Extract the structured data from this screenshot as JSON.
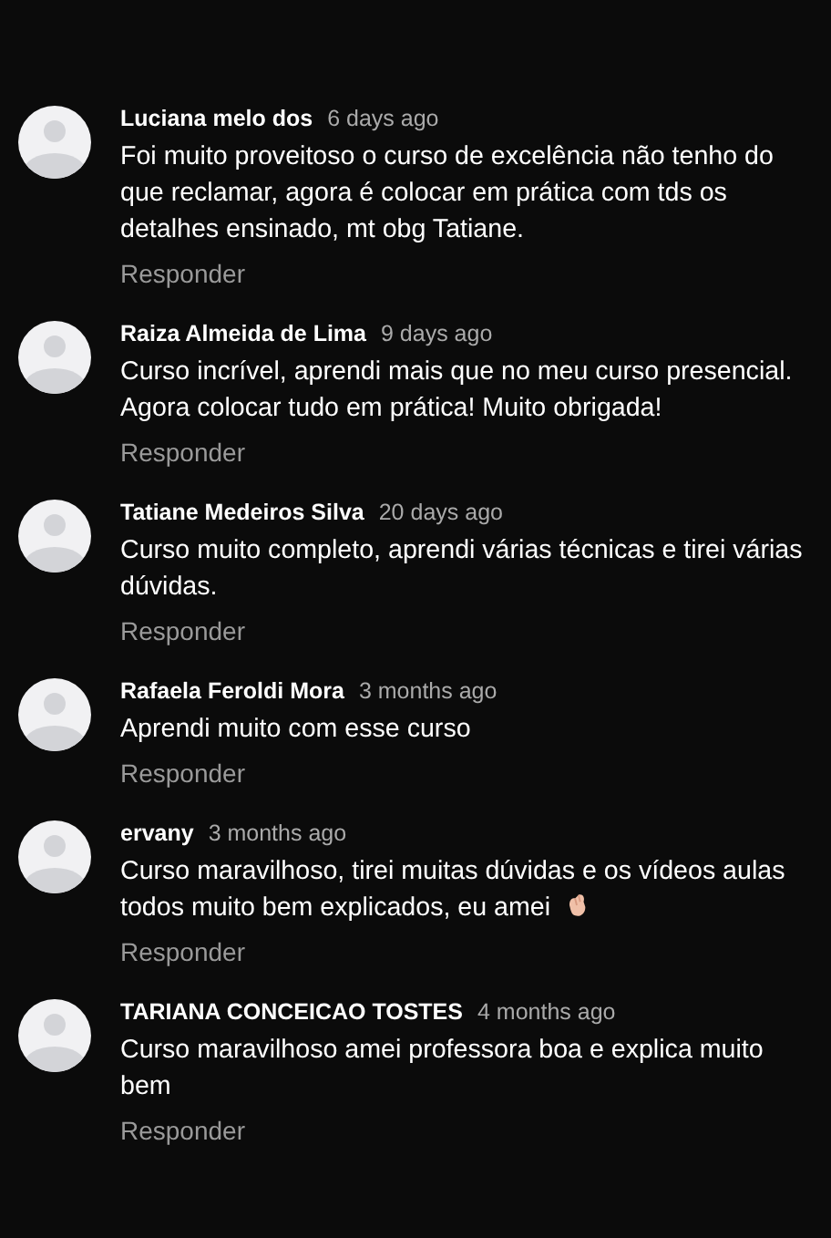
{
  "comments": [
    {
      "author": "Luciana melo dos",
      "time": "6 days ago",
      "text": "Foi muito proveitoso o curso de excelência não tenho do que reclamar, agora é colocar em prática com tds os detalhes ensinado, mt obg Tatiane.",
      "reply": "Responder"
    },
    {
      "author": "Raiza Almeida de Lima",
      "time": "9 days ago",
      "text": "Curso incrível, aprendi mais que no meu curso presencial. Agora colocar tudo em prática! Muito obrigada!",
      "reply": "Responder"
    },
    {
      "author": "Tatiane Medeiros Silva",
      "time": "20 days ago",
      "text": "Curso muito completo, aprendi várias técnicas e tirei várias dúvidas.",
      "reply": "Responder"
    },
    {
      "author": "Rafaela Feroldi Mora",
      "time": "3 months ago",
      "text": "Aprendi muito com esse curso",
      "reply": "Responder"
    },
    {
      "author": "ervany",
      "time": "3 months ago",
      "text": "Curso maravilhoso, tirei muitas dúvidas e os vídeos aulas todos muito bem explicados, eu amei",
      "reply": "Responder",
      "kind": "with-emoji"
    },
    {
      "author": "TARIANA CONCEICAO TOSTES",
      "time": "4 months ago",
      "text": "Curso maravilhoso amei professora boa e explica muito bem",
      "reply": "Responder"
    }
  ]
}
